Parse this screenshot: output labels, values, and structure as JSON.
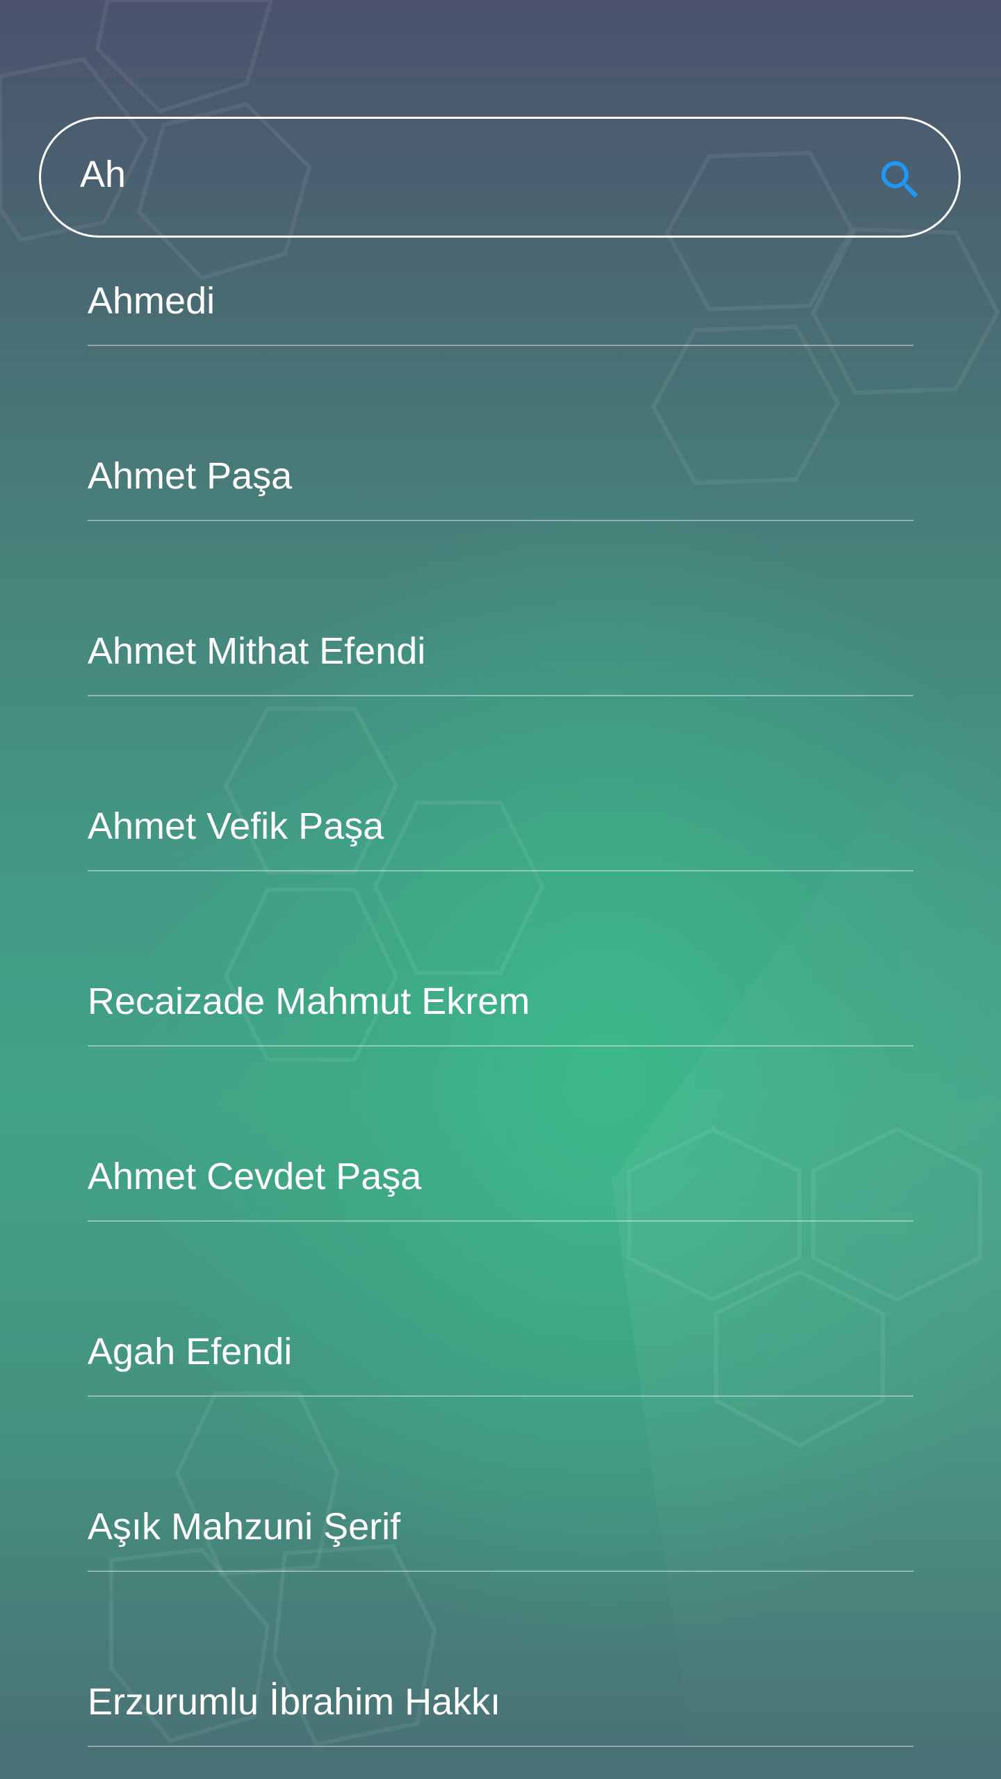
{
  "search": {
    "value": "Ah",
    "placeholder": ""
  },
  "results": [
    {
      "label": "Ahmedi"
    },
    {
      "label": "Ahmet Paşa"
    },
    {
      "label": "Ahmet Mithat Efendi"
    },
    {
      "label": "Ahmet Vefik Paşa"
    },
    {
      "label": "Recaizade Mahmut Ekrem"
    },
    {
      "label": "Ahmet Cevdet Paşa"
    },
    {
      "label": "Agah Efendi"
    },
    {
      "label": "Aşık Mahzuni Şerif"
    },
    {
      "label": "Erzurumlu İbrahim Hakkı"
    }
  ],
  "colors": {
    "accent": "#2196f3",
    "text": "#ffffff",
    "background_top": "#4b526d",
    "background_mid": "#41a386"
  },
  "icons": {
    "search": "search-icon"
  }
}
